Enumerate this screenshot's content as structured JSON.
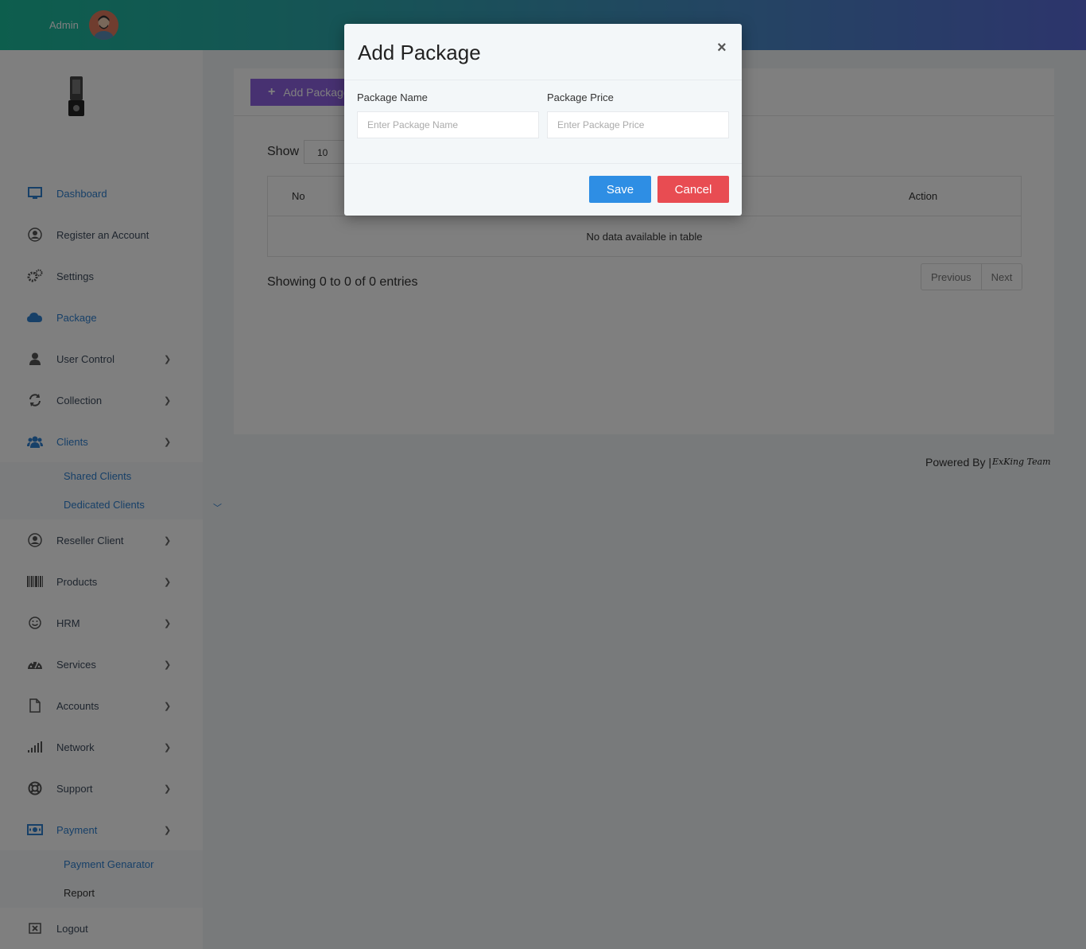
{
  "header": {
    "user_label": "Admin"
  },
  "sidebar": {
    "items": [
      {
        "label": "Dashboard",
        "icon": "monitor-icon",
        "active": true
      },
      {
        "label": "Register an Account",
        "icon": "user-circle-icon"
      },
      {
        "label": "Settings",
        "icon": "gears-icon"
      },
      {
        "label": "Package",
        "icon": "cloud-icon",
        "active": true
      },
      {
        "label": "User Control",
        "icon": "user-icon"
      },
      {
        "label": "Collection",
        "icon": "refresh-icon"
      },
      {
        "label": "Clients",
        "icon": "users-icon",
        "active": true
      },
      {
        "label": "Reseller Client",
        "icon": "user-circle-icon"
      },
      {
        "label": "Products",
        "icon": "barcode-icon"
      },
      {
        "label": "HRM",
        "icon": "smile-icon"
      },
      {
        "label": "Services",
        "icon": "dashboard-icon"
      },
      {
        "label": "Accounts",
        "icon": "file-icon"
      },
      {
        "label": "Network",
        "icon": "signal-icon"
      },
      {
        "label": "Support",
        "icon": "lifebuoy-icon"
      },
      {
        "label": "Payment",
        "icon": "money-icon",
        "active": true
      },
      {
        "label": "Logout",
        "icon": "close-box-icon"
      }
    ],
    "clients_sub": [
      "Shared Clients",
      "Dedicated Clients"
    ],
    "payment_sub": [
      "Payment Genarator",
      "Report"
    ]
  },
  "main": {
    "add_button": "Add Package",
    "show_label": "Show",
    "show_value": "10",
    "table": {
      "columns": [
        "No",
        "Action"
      ],
      "empty_text": "No data available in table"
    },
    "entries_text": "Showing 0 to 0 of 0 entries",
    "pager": {
      "previous": "Previous",
      "next": "Next"
    }
  },
  "footer": {
    "powered_by": "Powered By |",
    "team": "ExKing Team"
  },
  "modal": {
    "title": "Add Package",
    "close": "×",
    "name_label": "Package Name",
    "name_placeholder": "Enter Package Name",
    "price_label": "Package Price",
    "price_placeholder": "Enter Package Price",
    "save_label": "Save",
    "cancel_label": "Cancel"
  },
  "colors": {
    "accent": "#2f80d1",
    "save": "#2e8ee4",
    "cancel": "#e84c52",
    "add_button": "#8e62e3"
  }
}
